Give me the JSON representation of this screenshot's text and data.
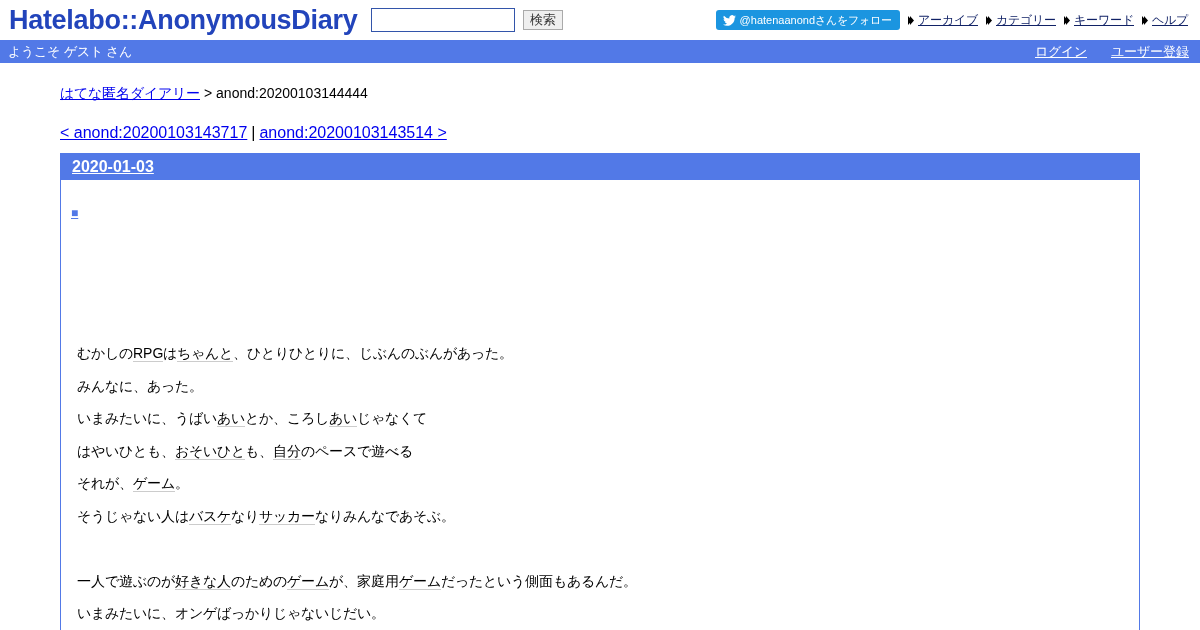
{
  "header": {
    "logo": "Hatelabo::AnonymousDiary",
    "search": {
      "button": "検索"
    },
    "follow_button": "@hatenaanondさんをフォロー",
    "nav_links": [
      "アーカイブ",
      "カテゴリー",
      "キーワード",
      "ヘルプ"
    ]
  },
  "user_bar": {
    "welcome": "ようこそ ゲスト さん",
    "links": [
      "ログイン",
      "ユーザー登録"
    ]
  },
  "breadcrumb": {
    "link": "はてな匿名ダイアリー",
    "current": "> anond:20200103144444"
  },
  "pager": {
    "prev": "< anond:20200103143717",
    "separator": "|",
    "next": "anond:20200103143514 >"
  },
  "entry": {
    "date": "2020-01-03",
    "anchor": "■",
    "paragraphs": [
      {
        "lines": [
          [
            {
              "text": "むかしの",
              "keyword": false
            },
            {
              "text": "RPG",
              "keyword": true
            },
            {
              "text": "は",
              "keyword": false
            },
            {
              "text": "ちゃんと",
              "keyword": true
            },
            {
              "text": "、ひとりひとりに、じぶんのぶんがあった。",
              "keyword": false
            }
          ],
          [
            {
              "text": "みんなに、あった。",
              "keyword": false
            }
          ],
          [
            {
              "text": "いまみたいに、うばい",
              "keyword": false
            },
            {
              "text": "あい",
              "keyword": true
            },
            {
              "text": "とか、ころし",
              "keyword": false
            },
            {
              "text": "あい",
              "keyword": true
            },
            {
              "text": "じゃなくて",
              "keyword": false
            }
          ],
          [
            {
              "text": "はやいひとも、",
              "keyword": false
            },
            {
              "text": "おそいひと",
              "keyword": true
            },
            {
              "text": "も、",
              "keyword": false
            },
            {
              "text": "自分",
              "keyword": true
            },
            {
              "text": "のペースで遊べる",
              "keyword": false
            }
          ],
          [
            {
              "text": "それが、",
              "keyword": false
            },
            {
              "text": "ゲーム",
              "keyword": true
            },
            {
              "text": "。",
              "keyword": false
            }
          ],
          [
            {
              "text": "そうじゃない人は",
              "keyword": false
            },
            {
              "text": "バスケ",
              "keyword": true
            },
            {
              "text": "なり",
              "keyword": false
            },
            {
              "text": "サッカー",
              "keyword": true
            },
            {
              "text": "なりみんなであそぶ。",
              "keyword": false
            }
          ]
        ]
      },
      {
        "lines": [
          [
            {
              "text": "一人で遊ぶのが",
              "keyword": false
            },
            {
              "text": "好きな人",
              "keyword": true
            },
            {
              "text": "のための",
              "keyword": false
            },
            {
              "text": "ゲーム",
              "keyword": true
            },
            {
              "text": "が、家庭用",
              "keyword": false
            },
            {
              "text": "ゲーム",
              "keyword": true
            },
            {
              "text": "だったという側面もあるんだ。",
              "keyword": false
            }
          ],
          [
            {
              "text": "いまみたいに、オンゲばっかりじゃないじだい。",
              "keyword": false
            }
          ]
        ]
      }
    ]
  }
}
